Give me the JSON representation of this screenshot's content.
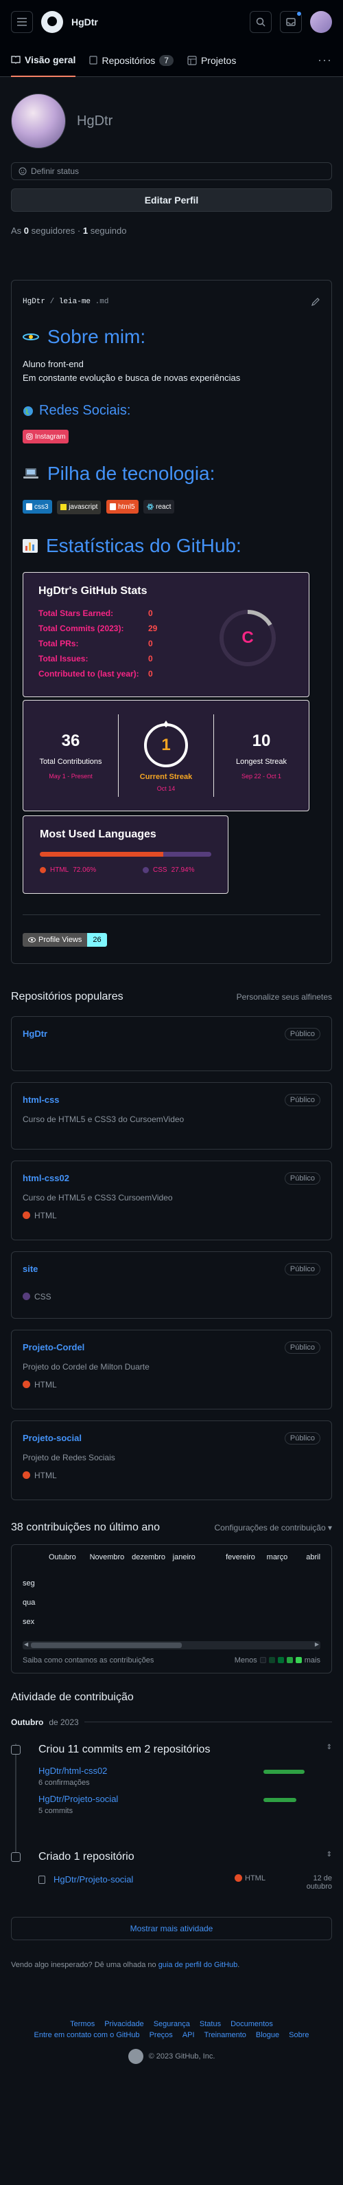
{
  "header": {
    "username": "HgDtr"
  },
  "tabs": [
    {
      "label": "Visão geral"
    },
    {
      "label": "Repositórios",
      "count": "7"
    },
    {
      "label": "Projetos"
    }
  ],
  "profile": {
    "name": "HgDtr",
    "status_label": "Definir status",
    "edit_label": "Editar Perfil",
    "followers_prefix": "As",
    "followers": "0",
    "followers_label": "seguidores",
    "following": "1",
    "following_label": "seguindo"
  },
  "readme": {
    "path_user": "HgDtr",
    "path_sep": " / ",
    "path_file": "leia-me",
    "path_ext": ".md",
    "about_title": "Sobre mim:",
    "about_line1": "Aluno front-end",
    "about_line2": "Em constante evolução e busca de novas experiências",
    "social_title": "Redes Sociais:",
    "instagram": "Instagram",
    "stack_title": "Pilha de tecnologia:",
    "badges": [
      "css3",
      "javascript",
      "html5",
      "react"
    ],
    "stats_title": "Estatísticas do GitHub:",
    "stats_card": {
      "title": "HgDtr's GitHub Stats",
      "rows": [
        {
          "label": "Total Stars Earned:",
          "value": "0"
        },
        {
          "label": "Total Commits (2023):",
          "value": "29"
        },
        {
          "label": "Total PRs:",
          "value": "0"
        },
        {
          "label": "Total Issues:",
          "value": "0"
        },
        {
          "label": "Contributed to (last year):",
          "value": "0"
        }
      ],
      "grade": "C"
    },
    "streak": {
      "total": "36",
      "total_label": "Total Contributions",
      "total_range": "May 1 - Present",
      "current": "1",
      "current_label": "Current Streak",
      "current_date": "Oct 14",
      "longest": "10",
      "longest_label": "Longest Streak",
      "longest_range": "Sep 22 - Oct 1"
    },
    "languages": {
      "title": "Most Used Languages",
      "items": [
        {
          "name": "HTML",
          "pct": "72.06%",
          "value": 72.06,
          "color": "#e34c26"
        },
        {
          "name": "CSS",
          "pct": "27.94%",
          "value": 27.94,
          "color": "#563d7c"
        }
      ]
    },
    "profile_views_label": "Profile Views",
    "profile_views": "26"
  },
  "pinned": {
    "title": "Repositórios populares",
    "customize": "Personalize seus alfinetes",
    "public_label": "Público",
    "repos": [
      {
        "name": "HgDtr",
        "desc": "",
        "lang": "",
        "color": ""
      },
      {
        "name": "html-css",
        "desc": "Curso de HTML5 e CSS3 do CursoemVideo",
        "lang": "",
        "color": ""
      },
      {
        "name": "html-css02",
        "desc": "Curso de HTML5 e CSS3 CursoemVideo",
        "lang": "HTML",
        "color": "#e34c26"
      },
      {
        "name": "site",
        "desc": "",
        "lang": "CSS",
        "color": "#563d7c"
      },
      {
        "name": "Projeto-Cordel",
        "desc": "Projeto do Cordel de Milton Duarte",
        "lang": "HTML",
        "color": "#e34c26"
      },
      {
        "name": "Projeto-social",
        "desc": "Projeto de Redes Sociais",
        "lang": "HTML",
        "color": "#e34c26"
      }
    ]
  },
  "contributions": {
    "title": "38 contribuições no último ano",
    "settings": "Configurações de contribuição",
    "months": [
      "Outubro",
      "Novembro",
      "dezembro",
      "janeiro",
      "fevereiro",
      "março",
      "abril"
    ],
    "days": [
      "seg",
      "qua",
      "sex"
    ],
    "learn": "Saiba como contamos as contribuições",
    "less": "Menos",
    "more": "mais"
  },
  "activity": {
    "title": "Atividade de contribuição",
    "month": "Outubro",
    "year": "de 2023",
    "commits_title": "Criou 11 commits em 2 repositórios",
    "commit_repos": [
      {
        "name": "HgDtr/html-css02",
        "count": "6 confirmações"
      },
      {
        "name": "HgDtr/Projeto-social",
        "count": "5 commits"
      }
    ],
    "created_title": "Criado 1 repositório",
    "created_repo": "HgDtr/Projeto-social",
    "created_lang": "HTML",
    "created_date_1": "12 de",
    "created_date_2": "outubro",
    "more_btn": "Mostrar mais atividade",
    "unexpected_prefix": "Vendo algo inesperado? Dê uma olhada no",
    "unexpected_link": "guia de perfil do GitHub",
    "unexpected_suffix": "."
  },
  "footer": {
    "row1": [
      "Termos",
      "Privacidade",
      "Segurança",
      "Status",
      "Documentos"
    ],
    "row2": [
      "Entre em contato com o GitHub",
      "Preços",
      "API",
      "Treinamento",
      "Blogue",
      "Sobre"
    ],
    "copyright": "© 2023 GitHub, Inc."
  }
}
